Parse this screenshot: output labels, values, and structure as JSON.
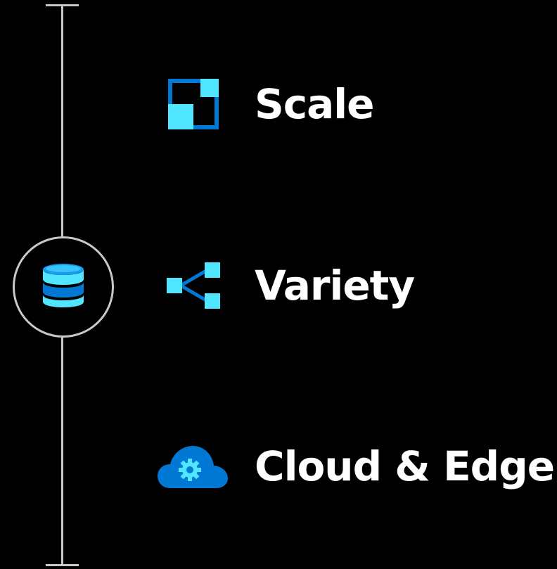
{
  "timeline": {
    "line_color": "#c8c8c8",
    "node_icon": "database-icon"
  },
  "features": [
    {
      "label": "Scale",
      "icon": "scale-icon"
    },
    {
      "label": "Variety",
      "icon": "variety-icon"
    },
    {
      "label": "Cloud & Edge",
      "icon": "cloud-edge-icon"
    }
  ],
  "colors": {
    "background": "#000000",
    "text": "#ffffff",
    "accent_light": "#50e6ff",
    "accent_dark": "#0078d4"
  }
}
